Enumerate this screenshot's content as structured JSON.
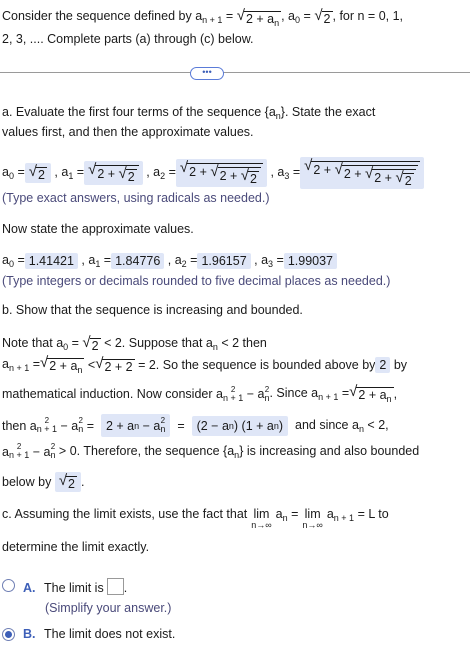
{
  "question": {
    "line1": "Consider the sequence defined by a",
    "line1_sub": "n + 1",
    "line1_eq": "=",
    "line1_radicand": "2 + a",
    "line1_radsub": "n",
    "line1_tail": ", a",
    "line1_tail_sub": "0",
    "line1_tail2": "=",
    "line1_tail2_rad": "2",
    "line1_tail3": ", for n = 0, 1,",
    "line2": "2, 3, .... Complete parts (a) through (c) below."
  },
  "expand_button_label": "•••",
  "part_a": {
    "prompt_line1": "a. Evaluate the first four terms of the sequence {a",
    "prompt_line1_sub": "n",
    "prompt_line1_tail": "}. State the exact",
    "prompt_line2": "values first, and then the approximate values.",
    "exact_hint": "(Type exact answers, using radicals as needed.)",
    "approx_intro": "Now state the approximate values.",
    "approx_values": [
      "1.41421",
      "1.84776",
      "1.96157",
      "1.99037"
    ],
    "approx_hint": "(Type integers or decimals rounded to five decimal places as needed.)"
  },
  "part_b": {
    "title": "b. Show that the sequence is increasing and bounded.",
    "bound_answer": "2",
    "expression": "2 + a",
    "factored": "(2 − a",
    "factored_mid": ") (1 + a",
    "factored_end": ")",
    "final_bound": "2"
  },
  "part_c": {
    "prompt": "c. Assuming the limit exists, use the fact that",
    "lim_word": "lim",
    "lim_under": "n→∞",
    "tail": "= L to",
    "line2": "determine the limit exactly.",
    "option_a_letter": "A.",
    "option_a_text": "The limit is",
    "option_a_hint": "(Simplify your answer.)",
    "option_b_letter": "B.",
    "option_b_text": "The limit does not exist.",
    "selected": "B"
  }
}
